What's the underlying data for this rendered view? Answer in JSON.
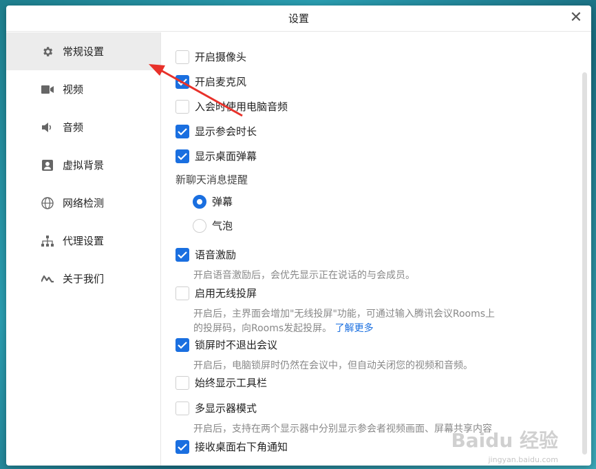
{
  "window": {
    "title": "设置",
    "close_glyph": "✕"
  },
  "sidebar": {
    "items": [
      {
        "label": "常规设置",
        "icon": "gear-icon",
        "active": true
      },
      {
        "label": "视频",
        "icon": "video-camera-icon"
      },
      {
        "label": "音频",
        "icon": "speaker-icon"
      },
      {
        "label": "虚拟背景",
        "icon": "portrait-icon"
      },
      {
        "label": "网络检测",
        "icon": "globe-icon"
      },
      {
        "label": "代理设置",
        "icon": "network-tree-icon"
      },
      {
        "label": "关于我们",
        "icon": "logo-icon"
      }
    ]
  },
  "settings": {
    "camera": {
      "label": "开启摄像头",
      "checked": false
    },
    "mic": {
      "label": "开启麦克风",
      "checked": true
    },
    "pc_audio": {
      "label": "入会时使用电脑音频",
      "checked": false
    },
    "duration": {
      "label": "显示参会时长",
      "checked": true
    },
    "danmaku": {
      "label": "显示桌面弹幕",
      "checked": true
    },
    "chat_section": "新聊天消息提醒",
    "chat_danmaku": {
      "label": "弹幕",
      "selected": true
    },
    "chat_bubble": {
      "label": "气泡",
      "selected": false
    },
    "voice_motivate": {
      "label": "语音激励",
      "checked": true,
      "desc": "开启语音激励后，会优先显示正在说话的与会成员。"
    },
    "wireless": {
      "label": "启用无线投屏",
      "checked": false,
      "desc1": "开启后，主界面会增加\"无线投屏\"功能，可通过输入腾讯会议Rooms上",
      "desc2": "的投屏码，向Rooms发起投屏。",
      "link": "了解更多"
    },
    "lock_stay": {
      "label": "锁屏时不退出会议",
      "checked": true,
      "desc": "开启后，电脑锁屏时仍然在会议中，但自动关闭您的视频和音频。"
    },
    "toolbar": {
      "label": "始终显示工具栏",
      "checked": false
    },
    "multi_display": {
      "label": "多显示器模式",
      "checked": false,
      "desc": "开启后，支持在两个显示器中分别显示参会者视频画面、屏幕共享内容"
    },
    "notify": {
      "label": "接收桌面右下角通知",
      "checked": true
    }
  },
  "watermark": {
    "text": "Baidu 经验",
    "sub": "jingyan.baidu.com"
  },
  "colors": {
    "accent": "#1a6fe0",
    "arrow": "#e8312a"
  }
}
